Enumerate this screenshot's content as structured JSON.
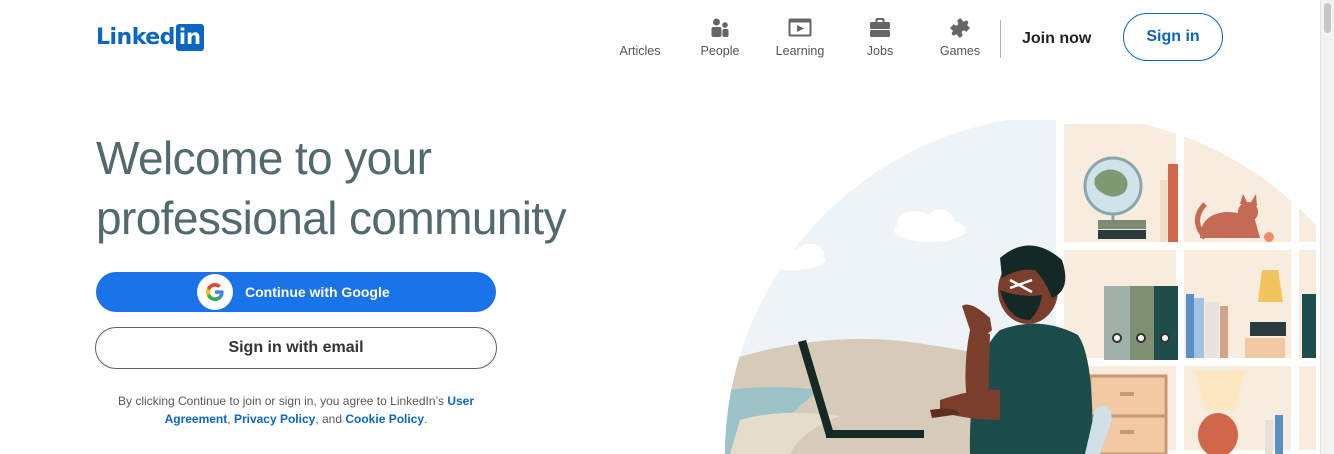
{
  "brand": {
    "logo_text": "Linked",
    "logo_box": "in",
    "color": "#0a66c2"
  },
  "nav": {
    "items": [
      {
        "label": "Articles",
        "icon": "newspaper-icon"
      },
      {
        "label": "People",
        "icon": "people-icon"
      },
      {
        "label": "Learning",
        "icon": "video-play-icon"
      },
      {
        "label": "Jobs",
        "icon": "briefcase-icon"
      },
      {
        "label": "Games",
        "icon": "puzzle-icon"
      }
    ],
    "join_now": "Join now",
    "sign_in": "Sign in"
  },
  "hero": {
    "headline_line1": "Welcome to your",
    "headline_line2": "professional community",
    "google_button": "Continue with Google",
    "email_button": "Sign in with email",
    "legal_prefix": "By clicking Continue to join or sign in, you agree to LinkedIn’s ",
    "legal_user_agreement": "User Agreement",
    "legal_sep1": ", ",
    "legal_privacy": "Privacy Policy",
    "legal_sep2": ", and ",
    "legal_cookie": "Cookie Policy",
    "legal_end": "."
  },
  "colors": {
    "headline": "#526a6e",
    "google_blue": "#1a73e8",
    "link": "#0a66c2"
  }
}
